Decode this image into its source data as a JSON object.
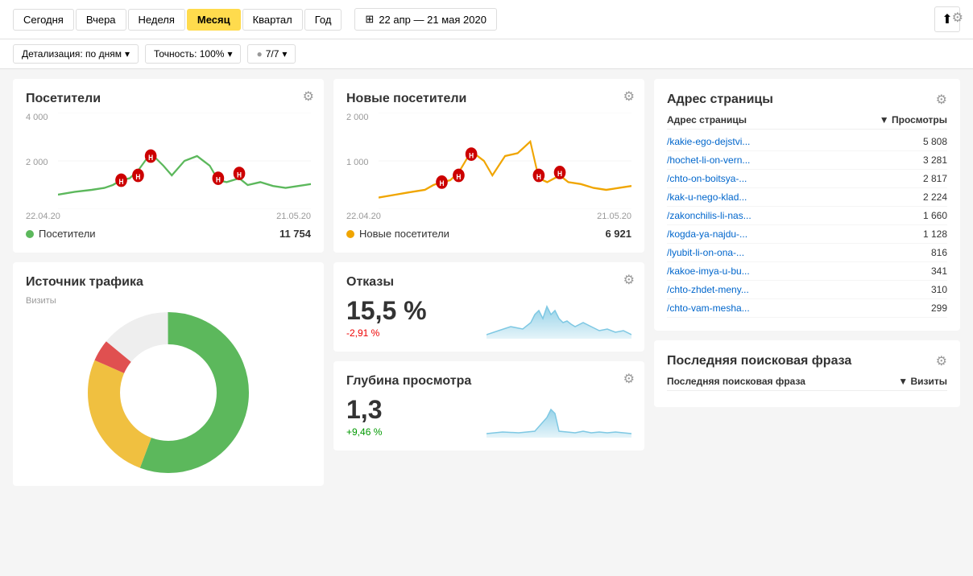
{
  "topBar": {
    "periodTabs": [
      {
        "id": "today",
        "label": "Сегодня",
        "active": false
      },
      {
        "id": "yesterday",
        "label": "Вчера",
        "active": false
      },
      {
        "id": "week",
        "label": "Неделя",
        "active": false
      },
      {
        "id": "month",
        "label": "Месяц",
        "active": true
      },
      {
        "id": "quarter",
        "label": "Квартал",
        "active": false
      },
      {
        "id": "year",
        "label": "Год",
        "active": false
      }
    ],
    "dateRange": "22 апр — 21 мая 2020",
    "exportIcon": "⬆"
  },
  "filterBar": {
    "detalization": "Детализация: по дням",
    "accuracy": "Точность: 100%",
    "segments": "7/7"
  },
  "visitors": {
    "title": "Посетители",
    "yLabels": [
      "4 000",
      "2 000"
    ],
    "dateStart": "22.04.20",
    "dateEnd": "21.05.20",
    "legendLabel": "Посетители",
    "value": "11 754",
    "color": "#5cb85c"
  },
  "newVisitors": {
    "title": "Новые посетители",
    "yLabels": [
      "2 000",
      "1 000"
    ],
    "dateStart": "22.04.20",
    "dateEnd": "21.05.20",
    "legendLabel": "Новые посетители",
    "value": "6 921",
    "color": "#f0a500"
  },
  "addressPage": {
    "title": "Адрес страницы",
    "colAddress": "Адрес страницы",
    "colViews": "▼ Просмотры",
    "rows": [
      {
        "url": "/kakie-ego-dejstvi...",
        "views": "5 808"
      },
      {
        "url": "/hochet-li-on-vern...",
        "views": "3 281"
      },
      {
        "url": "/chto-on-boitsya-...",
        "views": "2 817"
      },
      {
        "url": "/kak-u-nego-klad...",
        "views": "2 224"
      },
      {
        "url": "/zakonchilis-li-nas...",
        "views": "1 660"
      },
      {
        "url": "/kogda-ya-najdu-...",
        "views": "1 128"
      },
      {
        "url": "/lyubit-li-on-ona-...",
        "views": "816"
      },
      {
        "url": "/kakoe-imya-u-bu...",
        "views": "341"
      },
      {
        "url": "/chto-zhdet-meny...",
        "views": "310"
      },
      {
        "url": "/chto-vam-mesha...",
        "views": "299"
      }
    ]
  },
  "trafficSource": {
    "title": "Источник трафика",
    "subtitle": "Визиты"
  },
  "bounceRate": {
    "title": "Отказы",
    "value": "15,5 %",
    "change": "-2,91 %",
    "changeType": "negative"
  },
  "viewDepth": {
    "title": "Глубина просмотра",
    "value": "1,3",
    "change": "+9,46 %",
    "changeType": "positive"
  },
  "lastSearchPhrase": {
    "title": "Последняя поисковая фраза",
    "colPhrase": "Последняя поисковая фраза",
    "colVisits": "▼ Визиты"
  }
}
